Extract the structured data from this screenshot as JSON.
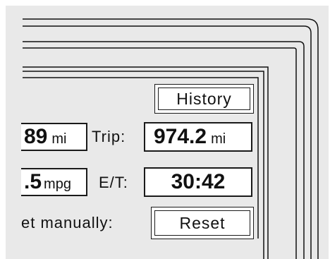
{
  "history_button": {
    "label": "History"
  },
  "trip": {
    "odometer_value": "89",
    "odometer_unit": "mi",
    "trip_label": "Trip:",
    "trip_value": "974.2",
    "trip_unit": "mi"
  },
  "economy": {
    "mpg_value": ".5",
    "mpg_unit": "mpg",
    "elapsed_label": "E/T:",
    "elapsed_value": "30:42"
  },
  "reset": {
    "label": "et manually:",
    "button_label": "Reset"
  },
  "colors": {
    "panel_bg": "#e9e9e9",
    "frame_line": "#111111",
    "field_bg": "#ffffff"
  }
}
